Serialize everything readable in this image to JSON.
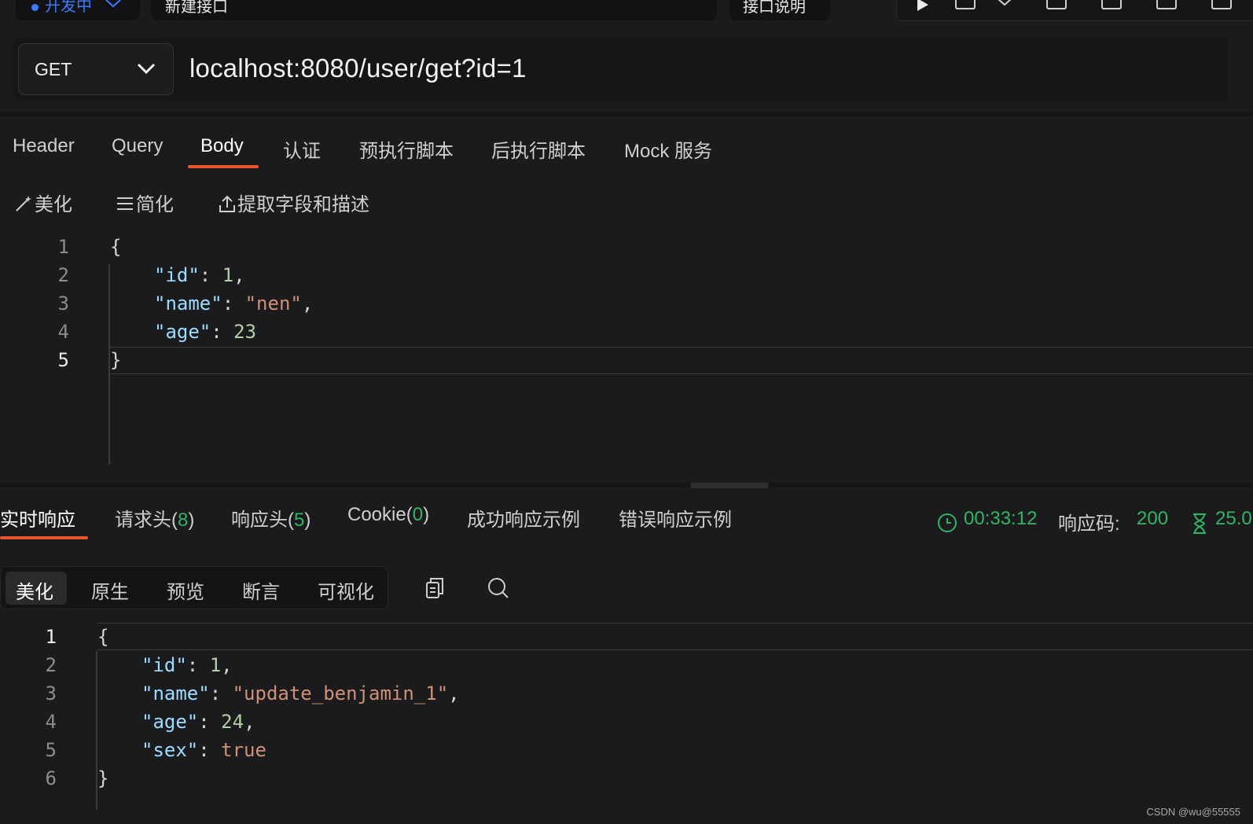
{
  "topbar": {
    "status_label": "开发中",
    "api_name": "新建接口",
    "doc_button": "接口说明"
  },
  "request": {
    "method": "GET",
    "url": "localhost:8080/user/get?id=1",
    "tabs": [
      "Header",
      "Query",
      "Body",
      "认证",
      "预执行脚本",
      "后执行脚本",
      "Mock 服务"
    ],
    "active_tab": "Body",
    "body_tools": {
      "beautify": "美化",
      "simplify": "简化",
      "extract": "提取字段和描述"
    },
    "body_line_numbers": [
      "1",
      "2",
      "3",
      "4",
      "5"
    ],
    "body_lines": {
      "l1": "{",
      "l2_key": "\"id\"",
      "l2_value": "1",
      "l3_key": "\"name\"",
      "l3_value": "\"nen\"",
      "l4_key": "\"age\"",
      "l4_value": "23",
      "l5": "}"
    }
  },
  "response": {
    "tabs": {
      "realtime": "实时响应",
      "req_headers": "请求头(",
      "req_headers_count": "8",
      "resp_headers": "响应头(",
      "resp_headers_count": "5",
      "cookie": "Cookie(",
      "cookie_count": "0",
      "close": ")",
      "success_example": "成功响应示例",
      "error_example": "错误响应示例"
    },
    "time": "00:33:12",
    "status_label": "响应码:",
    "status_code": "200",
    "duration": "25.0",
    "view_tabs": [
      "美化",
      "原生",
      "预览",
      "断言",
      "可视化"
    ],
    "active_view": "美化",
    "line_numbers": [
      "1",
      "2",
      "3",
      "4",
      "5",
      "6"
    ],
    "lines": {
      "l1": "{",
      "l2_key": "\"id\"",
      "l2_value": "1",
      "l3_key": "\"name\"",
      "l3_value": "\"update_benjamin_1\"",
      "l4_key": "\"age\"",
      "l4_value": "24",
      "l5_key": "\"sex\"",
      "l5_value": "true",
      "l6": "}"
    }
  },
  "watermark": "CSDN @wu@55555",
  "colors": {
    "accent_orange": "#e5542d",
    "status_blue": "#3d7bff",
    "success_green": "#2fb565",
    "json_key": "#9cdcfe",
    "json_string": "#ce9178",
    "json_number": "#b5cea8"
  }
}
